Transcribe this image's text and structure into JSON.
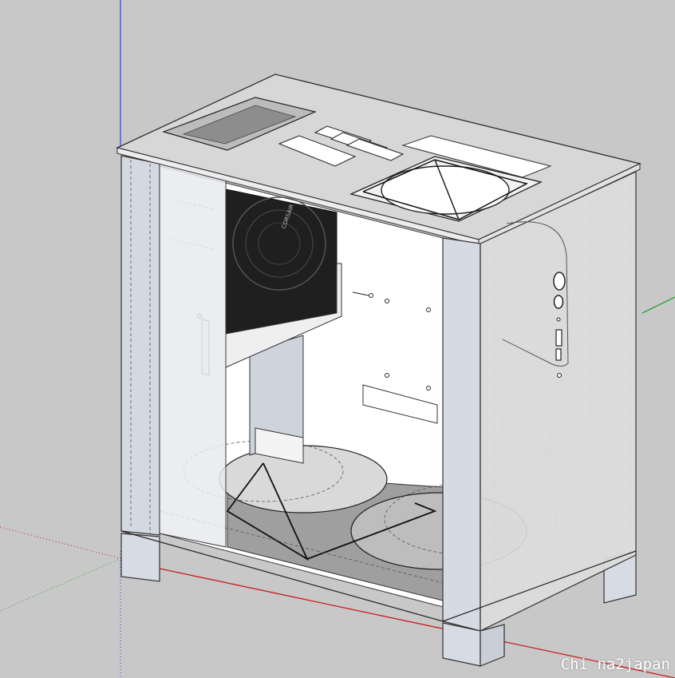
{
  "app": {
    "viewport_background": "#c8c8c8",
    "axis_colors": {
      "blue": "#3b3bd6",
      "red": "#c81e1e",
      "green": "#2aa12a"
    }
  },
  "model": {
    "subject": "pc-case-3d-model",
    "psu_label": "CORSAIR",
    "colors": {
      "panel_fill": "#dcdfe6",
      "glass_fill": "#e9ecef",
      "interior_fill": "#ffffff",
      "fan_dark": "#1e1e1e",
      "edge": "#3a3a3a",
      "floor_plate": "#9b9b9b"
    }
  },
  "watermark": {
    "text": "Chi na2japan"
  }
}
